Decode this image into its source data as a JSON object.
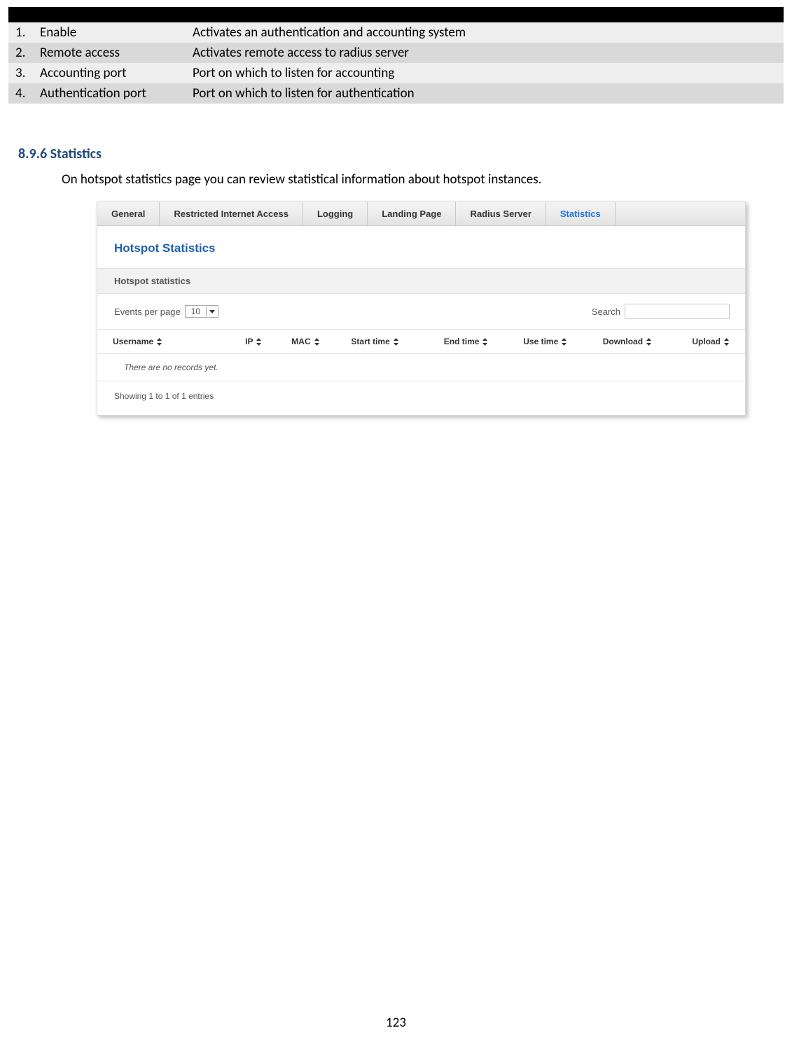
{
  "paramTable": {
    "header": {
      "num": "",
      "field": "",
      "desc": ""
    },
    "rows": [
      {
        "num": "1.",
        "field": "Enable",
        "desc": "Activates an authentication and accounting system"
      },
      {
        "num": "2.",
        "field": "Remote access",
        "desc": "Activates remote access to radius server"
      },
      {
        "num": "3.",
        "field": "Accounting port",
        "desc": "Port on which to listen for accounting"
      },
      {
        "num": "4.",
        "field": "Authentication port",
        "desc": "Port on which to listen for authentication"
      }
    ]
  },
  "section": {
    "heading": "8.9.6 Statistics",
    "body": "On hotspot statistics page you can review statistical information about hotspot instances."
  },
  "hotspot": {
    "tabs": [
      "General",
      "Restricted Internet Access",
      "Logging",
      "Landing Page",
      "Radius Server",
      "Statistics"
    ],
    "activeTab": "Statistics",
    "panelTitle": "Hotspot Statistics",
    "subheader": "Hotspot statistics",
    "eventsPerPageLabel": "Events per page",
    "eventsPerPageValue": "10",
    "searchLabel": "Search",
    "columns": [
      "Username",
      "IP",
      "MAC",
      "Start time",
      "End time",
      "Use time",
      "Download",
      "Upload"
    ],
    "noRecords": "There are no records yet.",
    "statusLine": "Showing 1 to 1 of 1 entries"
  },
  "pageNumber": "123"
}
